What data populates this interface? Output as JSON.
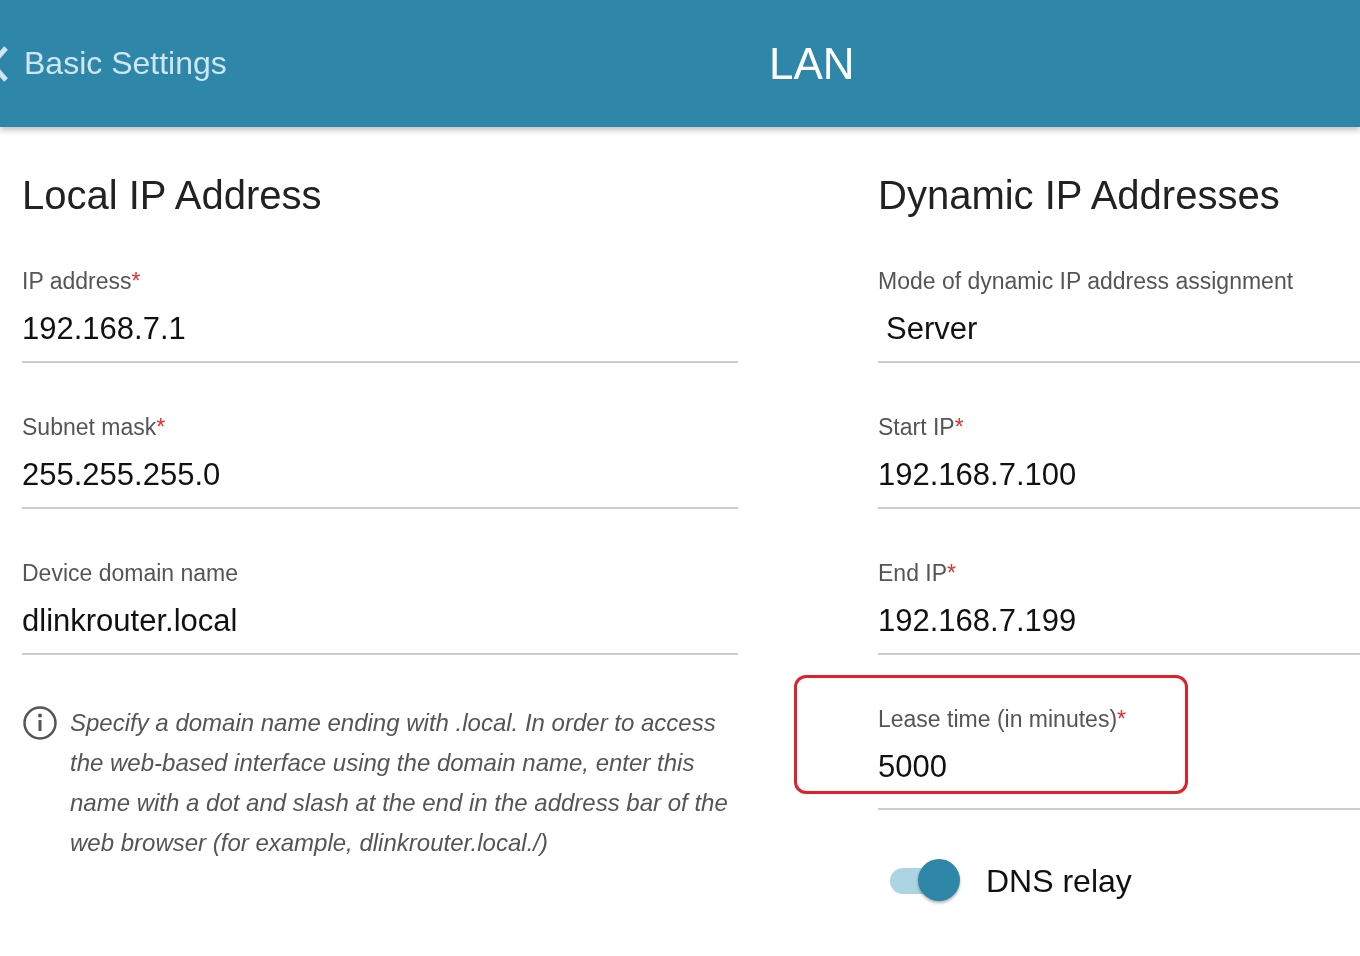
{
  "header": {
    "back_label": "Basic Settings",
    "title": "LAN"
  },
  "left": {
    "title": "Local IP Address",
    "fields": [
      {
        "kind": "input",
        "label": "IP address",
        "required_mark": "*",
        "value": "192.168.7.1"
      },
      {
        "kind": "input",
        "label": "Subnet mask",
        "required_mark": "*",
        "value": "255.255.255.0"
      },
      {
        "kind": "input",
        "label": "Device domain name",
        "value": "dlinkrouter.local"
      }
    ],
    "note": "Specify a domain name ending with .local. In order to access the web-based interface using the domain name, enter this name with a dot and slash at the end in the address bar of the web browser (for example, dlinkrouter.local./)"
  },
  "right": {
    "title": "Dynamic IP Addresses",
    "fields": [
      {
        "kind": "select",
        "label": "Mode of dynamic IP address assignment",
        "value": "Server",
        "highlighted": false
      },
      {
        "kind": "input",
        "label": "Start IP",
        "required_mark": "*",
        "value": "192.168.7.100",
        "highlighted": false
      },
      {
        "kind": "input",
        "label": "End IP",
        "required_mark": "*",
        "value": "192.168.7.199",
        "highlighted": false
      },
      {
        "kind": "input",
        "label": "Lease time (in minutes)",
        "required_mark": "*",
        "value": "5000",
        "highlighted": true
      }
    ],
    "toggle": {
      "label": "DNS relay",
      "on": true
    }
  }
}
